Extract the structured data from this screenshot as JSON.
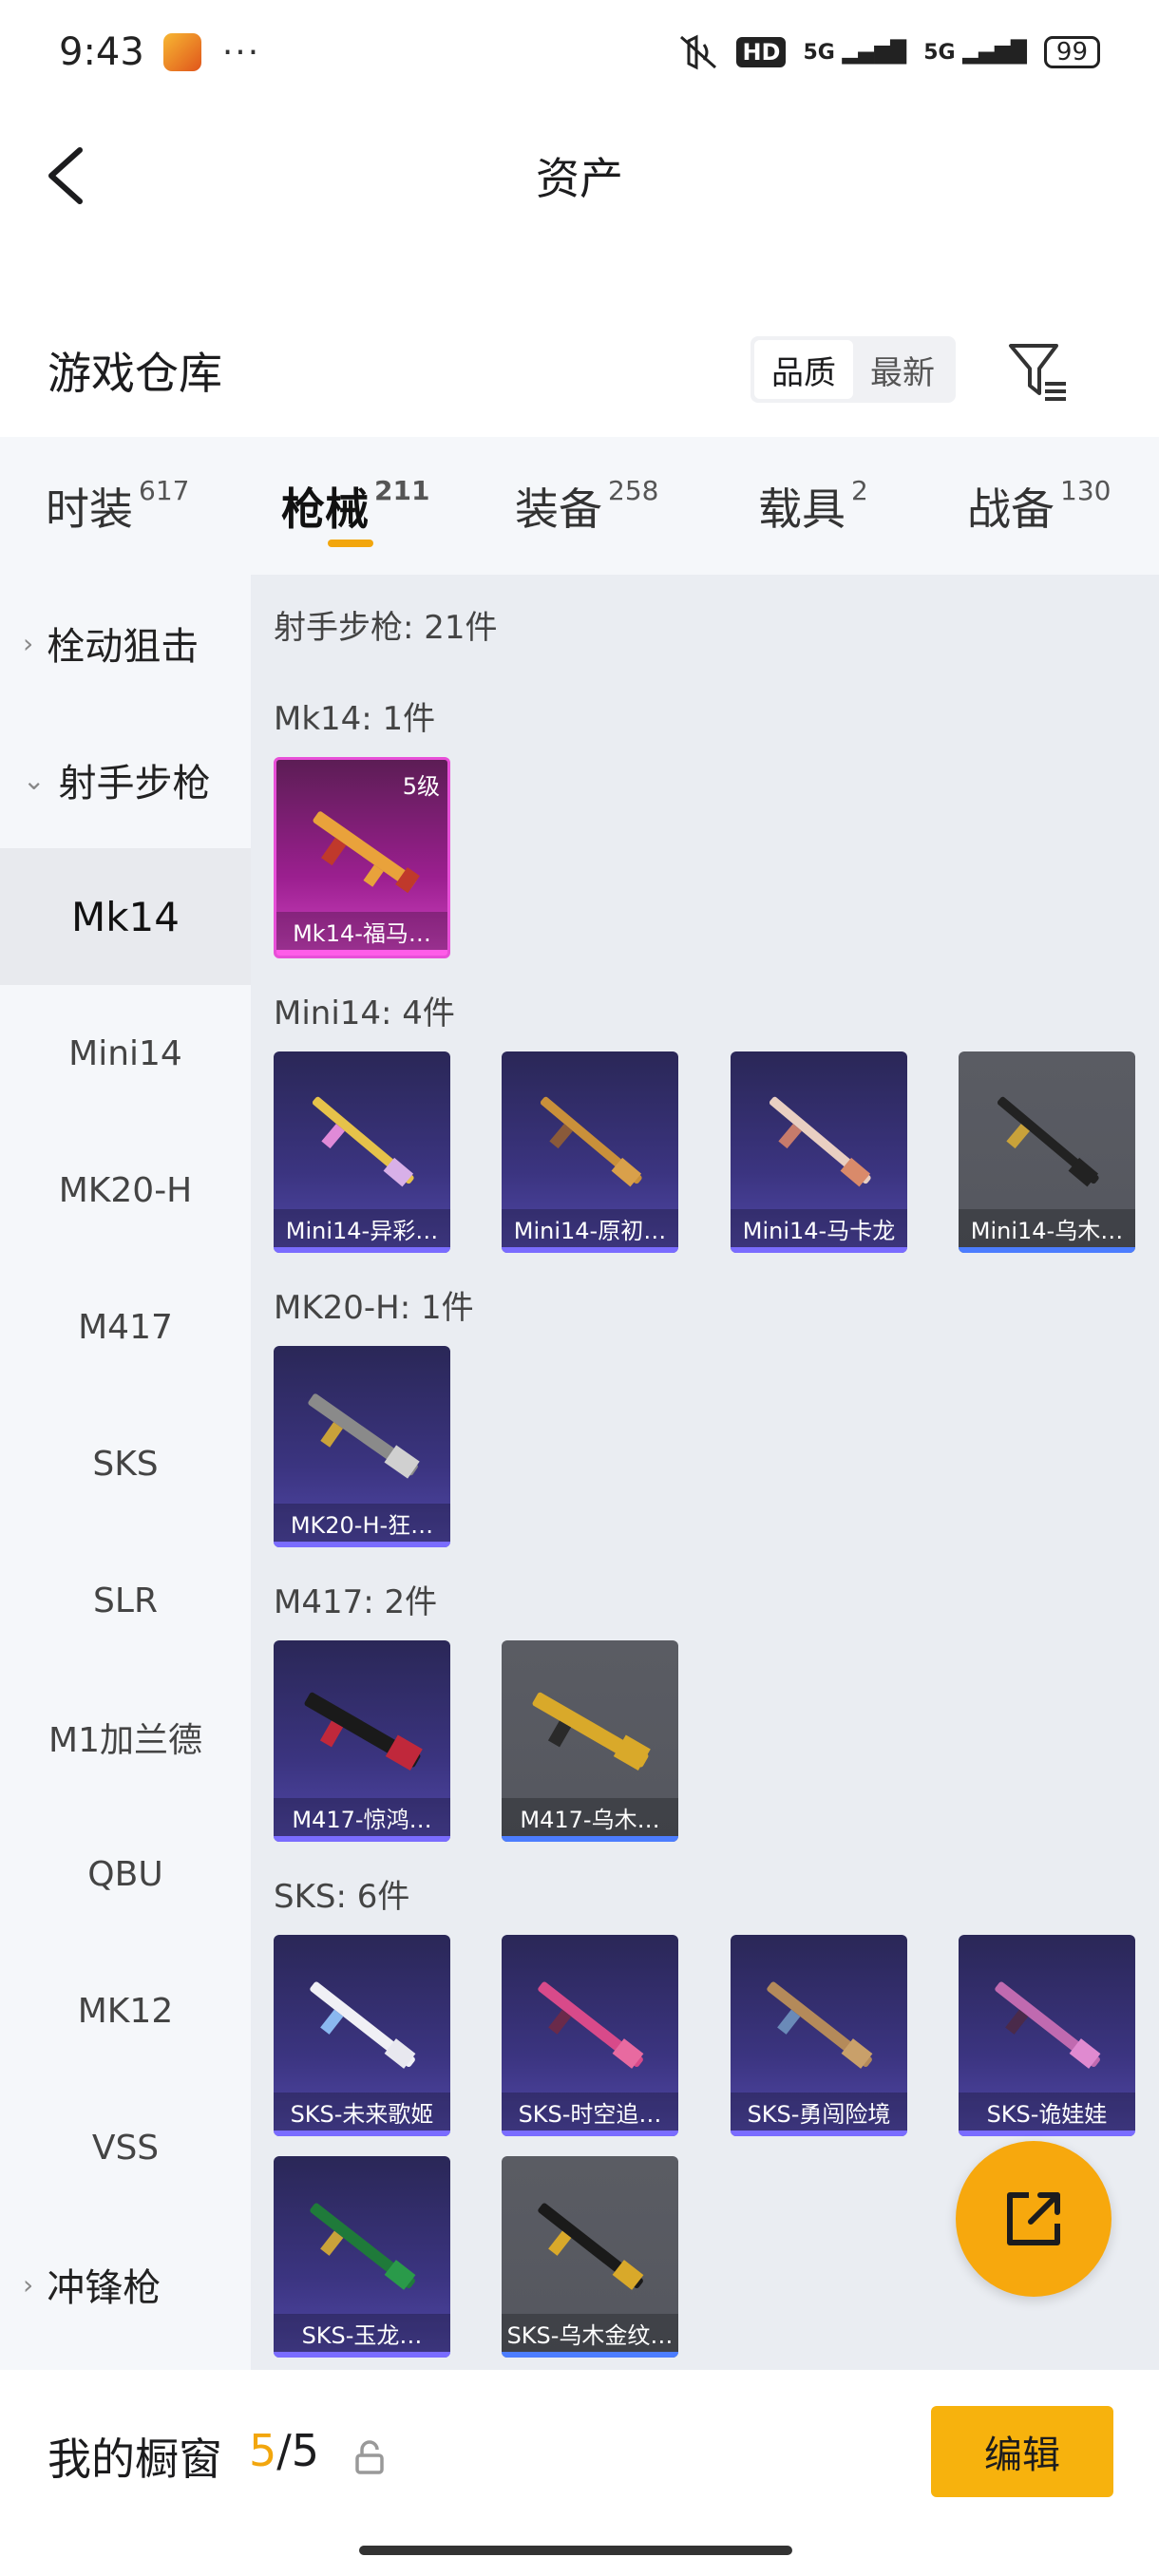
{
  "status_bar": {
    "time": "9:43",
    "dots": "···",
    "hd": "HD",
    "signal1": "5G",
    "signal2": "5G",
    "battery": "99"
  },
  "header": {
    "title": "资产"
  },
  "warehouse": {
    "title": "游戏仓库",
    "sort_quality": "品质",
    "sort_newest": "最新"
  },
  "tabs": [
    {
      "label": "时装",
      "count": "617"
    },
    {
      "label": "枪械",
      "count": "211"
    },
    {
      "label": "装备",
      "count": "258"
    },
    {
      "label": "载具",
      "count": "2"
    },
    {
      "label": "战备",
      "count": "130"
    }
  ],
  "sidebar": {
    "bolt": "栓动狙击",
    "marksman": "射手步枪",
    "items": [
      "Mk14",
      "Mini14",
      "MK20-H",
      "M417",
      "SKS",
      "SLR",
      "M1加兰德",
      "QBU",
      "MK12",
      "VSS"
    ],
    "smg": "冲锋枪"
  },
  "content": {
    "total": "射手步枪: 21件",
    "sections": [
      {
        "title": "Mk14: 1件",
        "items": [
          {
            "label": "Mk14-福马…",
            "level": "5级"
          }
        ]
      },
      {
        "title": "Mini14: 4件",
        "items": [
          {
            "label": "Mini14-异彩…"
          },
          {
            "label": "Mini14-原初…"
          },
          {
            "label": "Mini14-马卡龙"
          },
          {
            "label": "Mini14-乌木…"
          }
        ]
      },
      {
        "title": "MK20-H: 1件",
        "items": [
          {
            "label": "MK20-H-狂…"
          }
        ]
      },
      {
        "title": "M417: 2件",
        "items": [
          {
            "label": "M417-惊鸿…"
          },
          {
            "label": "M417-乌木…"
          }
        ]
      },
      {
        "title": "SKS: 6件",
        "items": [
          {
            "label": "SKS-未来歌姬"
          },
          {
            "label": "SKS-时空追…"
          },
          {
            "label": "SKS-勇闯险境"
          },
          {
            "label": "SKS-诡娃娃"
          },
          {
            "label": "SKS-玉龙…"
          },
          {
            "label": "SKS-乌木金纹…"
          }
        ]
      }
    ]
  },
  "bottom": {
    "showcase_label": "我的橱窗",
    "count_current": "5",
    "count_total": "/5",
    "edit_label": "编辑"
  }
}
